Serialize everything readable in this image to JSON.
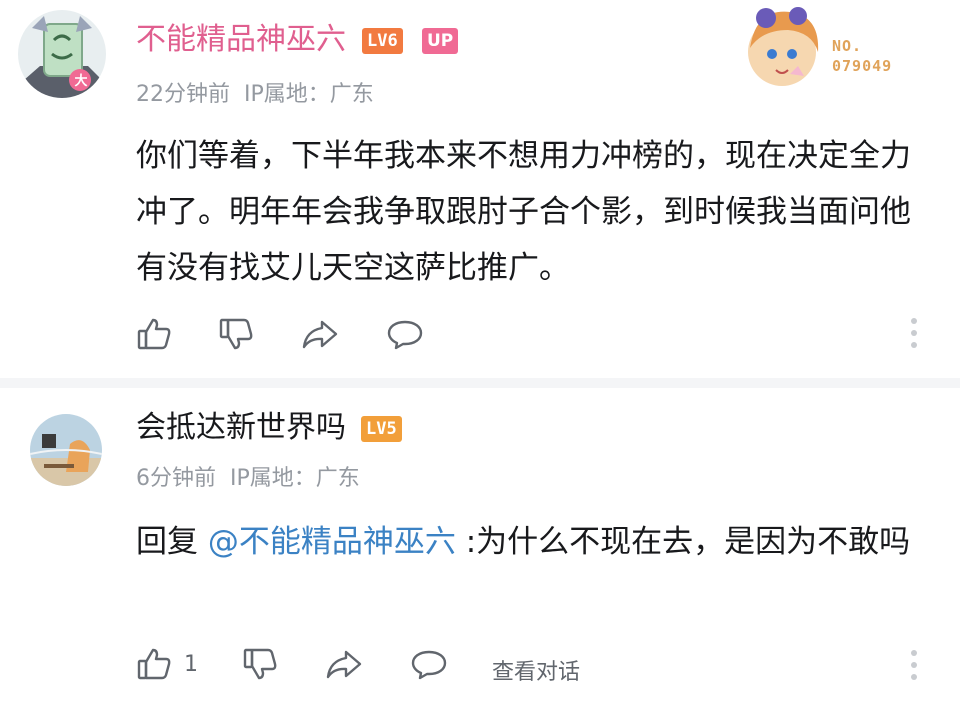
{
  "comments": [
    {
      "username": "不能精品神巫六",
      "level_badge": "LV6",
      "up_badge": "UP",
      "time": "22分钟前",
      "ip": "IP属地：广东",
      "text": "你们等着，下半年我本来不想用力冲榜的，现在决定全力冲了。明年年会我争取跟肘子合个影，到时候我当面问他有没有找艾儿天空这萨比推广。",
      "fan_label": "NO.",
      "fan_number": "079049",
      "avatar_badge": "大"
    },
    {
      "username": "会抵达新世界吗",
      "level_badge": "LV5",
      "time": "6分钟前",
      "ip": "IP属地：广东",
      "reply_prefix": "回复 ",
      "mention": "@不能精品神巫六",
      "text": " :为什么不现在去，是因为不敢吗",
      "like_count": "1",
      "view_conversation": "查看对话"
    }
  ],
  "colors": {
    "uploader_name": "#e05f8f",
    "mention": "#3b82c4",
    "lv6": "#f27a40",
    "lv5": "#f29f3a",
    "up": "#f06a94",
    "meta": "#9499a0"
  }
}
